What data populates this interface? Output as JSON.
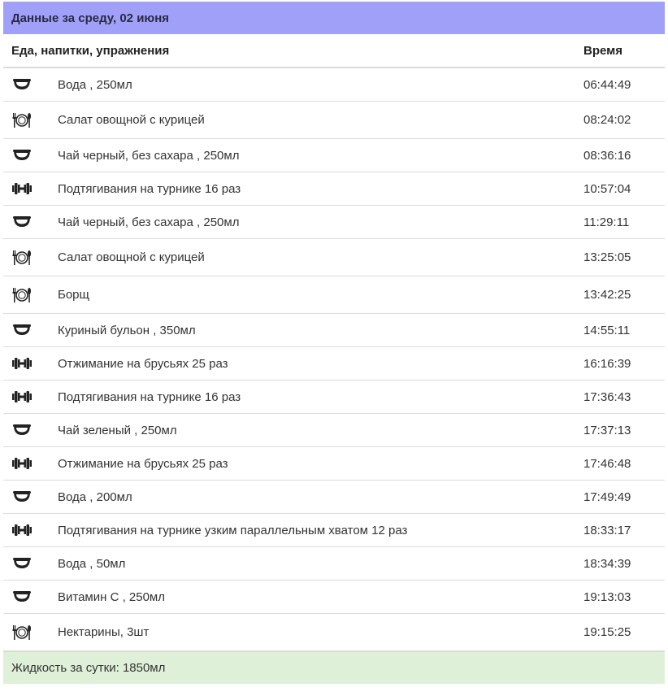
{
  "header": {
    "title": "Данные за среду, 02 июня"
  },
  "columns": {
    "description": "Еда, напитки, упражнения",
    "time": "Время"
  },
  "rows": [
    {
      "type": "drink",
      "icon": "bowl-icon",
      "description": "Вода , 250мл",
      "time": "06:44:49"
    },
    {
      "type": "food",
      "icon": "plate-cutlery-icon",
      "description": "Салат овощной с курицей",
      "time": "08:24:02"
    },
    {
      "type": "drink",
      "icon": "bowl-icon",
      "description": "Чай черный, без сахара , 250мл",
      "time": "08:36:16"
    },
    {
      "type": "exercise",
      "icon": "dumbbell-icon",
      "description": "Подтягивания на турнике 16 раз",
      "time": "10:57:04"
    },
    {
      "type": "drink",
      "icon": "bowl-icon",
      "description": "Чай черный, без сахара , 250мл",
      "time": "11:29:11"
    },
    {
      "type": "food",
      "icon": "plate-cutlery-icon",
      "description": "Салат овощной с курицей",
      "time": "13:25:05"
    },
    {
      "type": "food",
      "icon": "plate-cutlery-icon",
      "description": "Борщ",
      "time": "13:42:25"
    },
    {
      "type": "drink",
      "icon": "bowl-icon",
      "description": "Куриный бульон , 350мл",
      "time": "14:55:11"
    },
    {
      "type": "exercise",
      "icon": "dumbbell-icon",
      "description": "Отжимание на брусьях 25 раз",
      "time": "16:16:39"
    },
    {
      "type": "exercise",
      "icon": "dumbbell-icon",
      "description": "Подтягивания на турнике 16 раз",
      "time": "17:36:43"
    },
    {
      "type": "drink",
      "icon": "bowl-icon",
      "description": "Чай зеленый , 250мл",
      "time": "17:37:13"
    },
    {
      "type": "exercise",
      "icon": "dumbbell-icon",
      "description": "Отжимание на брусьях 25 раз",
      "time": "17:46:48"
    },
    {
      "type": "drink",
      "icon": "bowl-icon",
      "description": "Вода , 200мл",
      "time": "17:49:49"
    },
    {
      "type": "exercise",
      "icon": "dumbbell-icon",
      "description": "Подтягивания на турнике узким параллельным хватом 12 раз",
      "time": "18:33:17"
    },
    {
      "type": "drink",
      "icon": "bowl-icon",
      "description": "Вода , 50мл",
      "time": "18:34:39"
    },
    {
      "type": "drink",
      "icon": "bowl-icon",
      "description": "Витамин С , 250мл",
      "time": "19:13:03"
    },
    {
      "type": "food",
      "icon": "plate-cutlery-icon",
      "description": "Нектарины, 3шт",
      "time": "19:15:25"
    }
  ],
  "footer": {
    "total": "Жидкость за сутки: 1850мл"
  },
  "colors": {
    "header_bg": "#a0a0f8",
    "footer_bg": "#dff0d8",
    "border": "#dcdcdc"
  }
}
